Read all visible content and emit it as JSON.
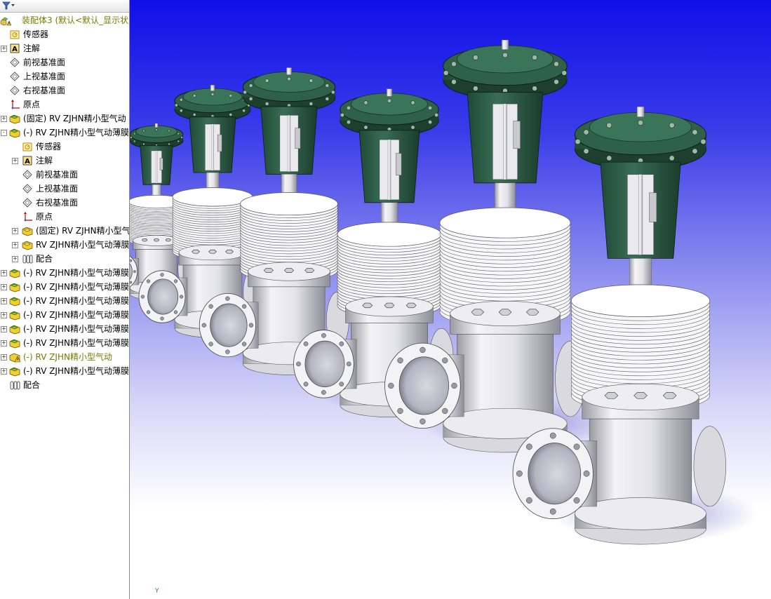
{
  "tree": {
    "filter_icon": "filter-icon",
    "root": {
      "label": "装配体3  (默认<默认_显示状",
      "icon": "assembly-warning-icon"
    },
    "items": [
      {
        "label": "传感器",
        "icon": "sensor-icon",
        "level": 1,
        "expander": ""
      },
      {
        "label": "注解",
        "icon": "annotation-icon",
        "level": 1,
        "expander": "+"
      },
      {
        "label": "前视基准面",
        "icon": "plane-icon",
        "level": 1,
        "expander": ""
      },
      {
        "label": "上视基准面",
        "icon": "plane-icon",
        "level": 1,
        "expander": ""
      },
      {
        "label": "右视基准面",
        "icon": "plane-icon",
        "level": 1,
        "expander": ""
      },
      {
        "label": "原点",
        "icon": "origin-icon",
        "level": 1,
        "expander": ""
      },
      {
        "label": "(固定) RV ZJHN精小型气动",
        "icon": "part-icon",
        "level": 1,
        "expander": "+"
      },
      {
        "label": "(-) RV ZJHN精小型气动薄膜",
        "icon": "part-icon",
        "level": 1,
        "expander": "-"
      },
      {
        "label": "传感器",
        "icon": "sensor-icon",
        "level": 2,
        "expander": ""
      },
      {
        "label": "注解",
        "icon": "annotation-icon",
        "level": 2,
        "expander": "+"
      },
      {
        "label": "前视基准面",
        "icon": "plane-icon",
        "level": 2,
        "expander": ""
      },
      {
        "label": "上视基准面",
        "icon": "plane-icon",
        "level": 2,
        "expander": ""
      },
      {
        "label": "右视基准面",
        "icon": "plane-icon",
        "level": 2,
        "expander": ""
      },
      {
        "label": "原点",
        "icon": "origin-icon",
        "level": 2,
        "expander": ""
      },
      {
        "label": "(固定) RV ZJHN精小型气",
        "icon": "subpart-icon",
        "level": 2,
        "expander": "+"
      },
      {
        "label": "RV ZJHN精小型气动薄膜",
        "icon": "subpart-icon",
        "level": 2,
        "expander": "+"
      },
      {
        "label": "配合",
        "icon": "mate-icon",
        "level": 2,
        "expander": "+"
      },
      {
        "label": "(-) RV ZJHN精小型气动薄膜",
        "icon": "part-icon",
        "level": 1,
        "expander": "+"
      },
      {
        "label": "(-) RV ZJHN精小型气动薄膜",
        "icon": "part-icon",
        "level": 1,
        "expander": "+"
      },
      {
        "label": "(-) RV ZJHN精小型气动薄膜",
        "icon": "part-icon",
        "level": 1,
        "expander": "+"
      },
      {
        "label": "(-) RV ZJHN精小型气动薄膜",
        "icon": "part-icon",
        "level": 1,
        "expander": "+"
      },
      {
        "label": "(-) RV ZJHN精小型气动薄膜",
        "icon": "part-icon",
        "level": 1,
        "expander": "+"
      },
      {
        "label": "(-) RV ZJHN精小型气动薄膜",
        "icon": "part-icon",
        "level": 1,
        "expander": "+"
      },
      {
        "label": "(-) RV ZJHN精小型气动",
        "icon": "part-warning-icon",
        "level": 1,
        "expander": "+",
        "warning": true
      },
      {
        "label": "(-) RV ZJHN精小型气动薄膜",
        "icon": "part-icon",
        "level": 1,
        "expander": "+"
      },
      {
        "label": "配合",
        "icon": "mate-icon",
        "level": 1,
        "expander": ""
      }
    ]
  },
  "viewport": {
    "triad_label": "Y",
    "valves": 6
  },
  "colors": {
    "bg_top": "#0f10e8",
    "bg_bottom": "#ffffff",
    "actuator_green": "#2d5a45",
    "body_silver": "#e6e6ea"
  }
}
